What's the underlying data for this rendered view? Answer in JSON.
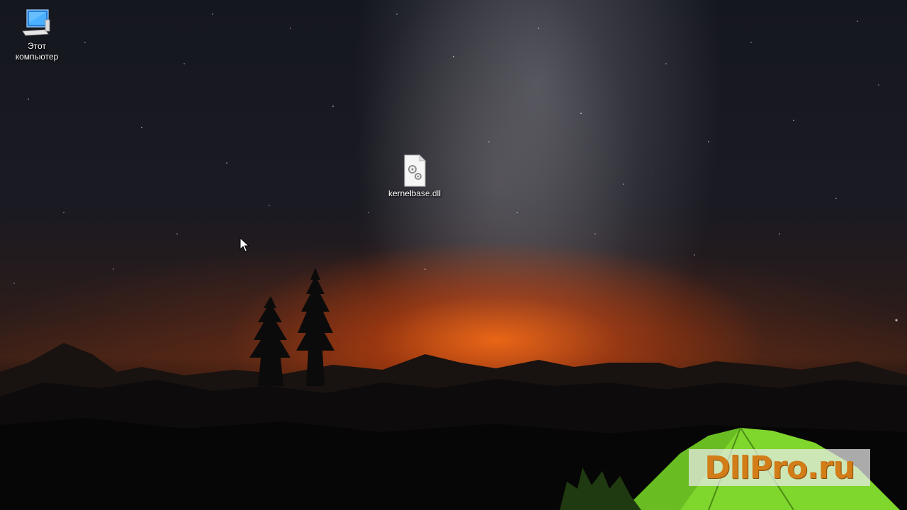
{
  "desktop": {
    "icons": [
      {
        "label": "Этот компьютер",
        "icon": "computer-icon"
      },
      {
        "label": "kernelbase.dll",
        "icon": "dll-file-icon"
      }
    ]
  },
  "watermark": {
    "text": "DllPro.ru"
  },
  "colors": {
    "horizon_glow": "#ff7a1a",
    "tent": "#7cd62a",
    "watermark_text": "#d27d18"
  }
}
